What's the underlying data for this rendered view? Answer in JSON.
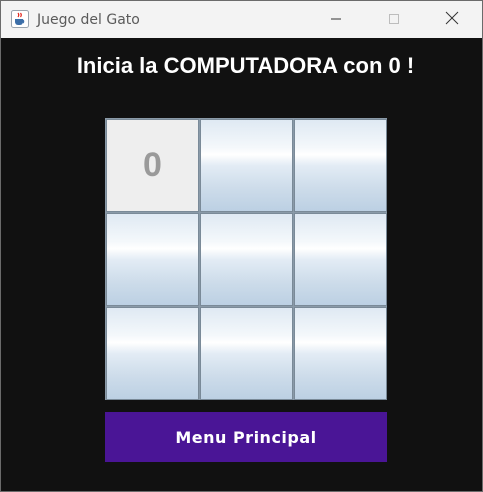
{
  "window": {
    "title": "Juego del Gato"
  },
  "icons": {
    "app": "java-coffee-cup-icon",
    "minimize": "minimize-icon",
    "maximize": "maximize-icon",
    "close": "close-icon"
  },
  "main": {
    "heading": "Inicia la COMPUTADORA con 0 !",
    "board": [
      [
        "0",
        "",
        ""
      ],
      [
        "",
        "",
        ""
      ],
      [
        "",
        "",
        ""
      ]
    ],
    "menu_button_label": "Menu Principal"
  },
  "colors": {
    "background": "#111111",
    "button": "#4a1596",
    "mark": "#9a9a9a"
  }
}
